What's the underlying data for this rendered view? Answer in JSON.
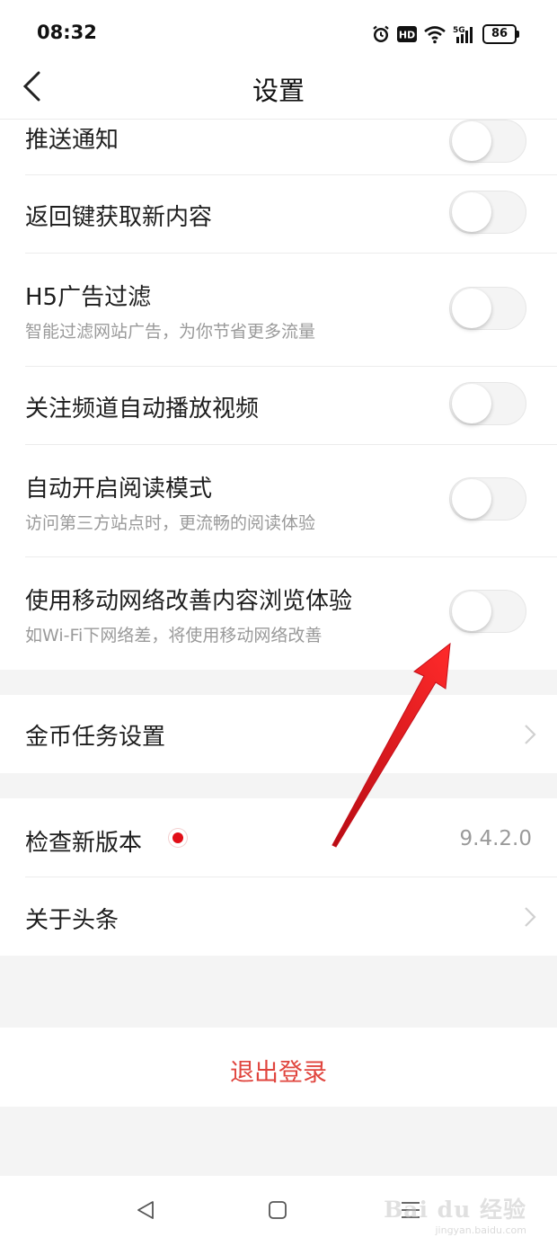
{
  "status_bar": {
    "time": "08:32",
    "network": "5G",
    "battery": "86"
  },
  "header": {
    "title": "设置"
  },
  "settings": [
    {
      "label": "推送通知"
    },
    {
      "label": "返回键获取新内容"
    },
    {
      "label": "H5广告过滤",
      "description": "智能过滤网站广告，为你节省更多流量"
    },
    {
      "label": "关注频道自动播放视频"
    },
    {
      "label": "自动开启阅读模式",
      "description": "访问第三方站点时，更流畅的阅读体验"
    },
    {
      "label": "使用移动网络改善内容浏览体验",
      "description": "如Wi-Fi下网络差，将使用移动网络改善"
    }
  ],
  "toggles": {
    "state": "off"
  },
  "coin_task": {
    "label": "金币任务设置"
  },
  "check_version": {
    "label": "检查新版本",
    "version": "9.4.2.0"
  },
  "about": {
    "label": "关于头条"
  },
  "logout": {
    "label": "退出登录"
  },
  "watermark": {
    "brand": "Bai du 经验",
    "url": "jingyan.baidu.com"
  },
  "colors": {
    "accent_red": "#e10e17",
    "logout_text": "#e0453e",
    "annotation_arrow": "#e8121e",
    "section_gap": "#f4f4f4"
  },
  "icons": [
    "alarm-icon",
    "hd-icon",
    "wifi-icon",
    "signal-icon",
    "battery-icon",
    "back-chevron-icon",
    "chevron-right-icon",
    "nav-back-icon",
    "nav-home-icon",
    "nav-menu-icon",
    "annotation-arrow"
  ]
}
